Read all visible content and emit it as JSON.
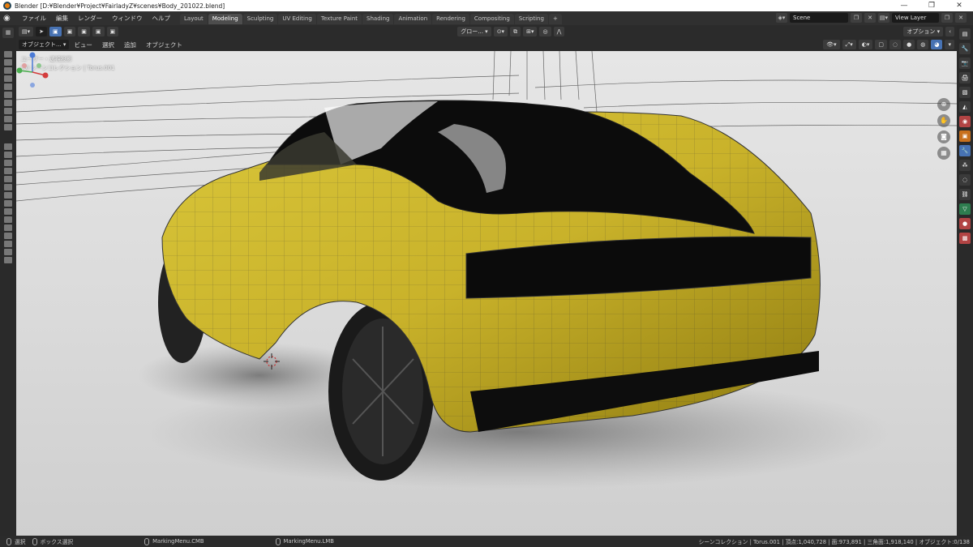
{
  "window": {
    "title": "Blender [D:¥Blender¥Project¥FairladyZ¥scenes¥Body_201022.blend]",
    "minimize": "—",
    "maximize": "❐",
    "close": "✕"
  },
  "menu": [
    "ファイル",
    "編集",
    "レンダー",
    "ウィンドウ",
    "ヘルプ"
  ],
  "workspaces": [
    {
      "label": "Layout",
      "active": false
    },
    {
      "label": "Modeling",
      "active": true
    },
    {
      "label": "Sculpting",
      "active": false
    },
    {
      "label": "UV Editing",
      "active": false
    },
    {
      "label": "Texture Paint",
      "active": false
    },
    {
      "label": "Shading",
      "active": false
    },
    {
      "label": "Animation",
      "active": false
    },
    {
      "label": "Rendering",
      "active": false
    },
    {
      "label": "Compositing",
      "active": false
    },
    {
      "label": "Scripting",
      "active": false
    }
  ],
  "add_workspace": "+",
  "scene": {
    "name": "Scene"
  },
  "view_layer": {
    "name": "View Layer"
  },
  "viewport_header": {
    "mode": "オブジェクト...",
    "menus": [
      "ビュー",
      "選択",
      "追加",
      "オブジェクト"
    ],
    "orientation": "グロー...",
    "options": "オプション"
  },
  "viewport": {
    "view_name": "ユーザー・透視投影",
    "collection_info": "(0) シーンコレクション | Torus.001"
  },
  "statusbar": {
    "select": "選択",
    "box_select": "ボックス選択",
    "marking_cmb": "MarkingMenu.CMB",
    "marking_lmb": "MarkingMenu.LMB",
    "stats": "シーンコレクション | Torus.001 | 頂点:1,040,728 | 面:973,891 | 三角面:1,918,140 | オブジェクト:0/138"
  },
  "icons": {
    "blender": "blender-logo-icon",
    "cursor": "cursor-icon",
    "zoom": "zoom-icon",
    "hand": "hand-pan-icon",
    "camera": "camera-icon",
    "grid": "grid-icon"
  }
}
